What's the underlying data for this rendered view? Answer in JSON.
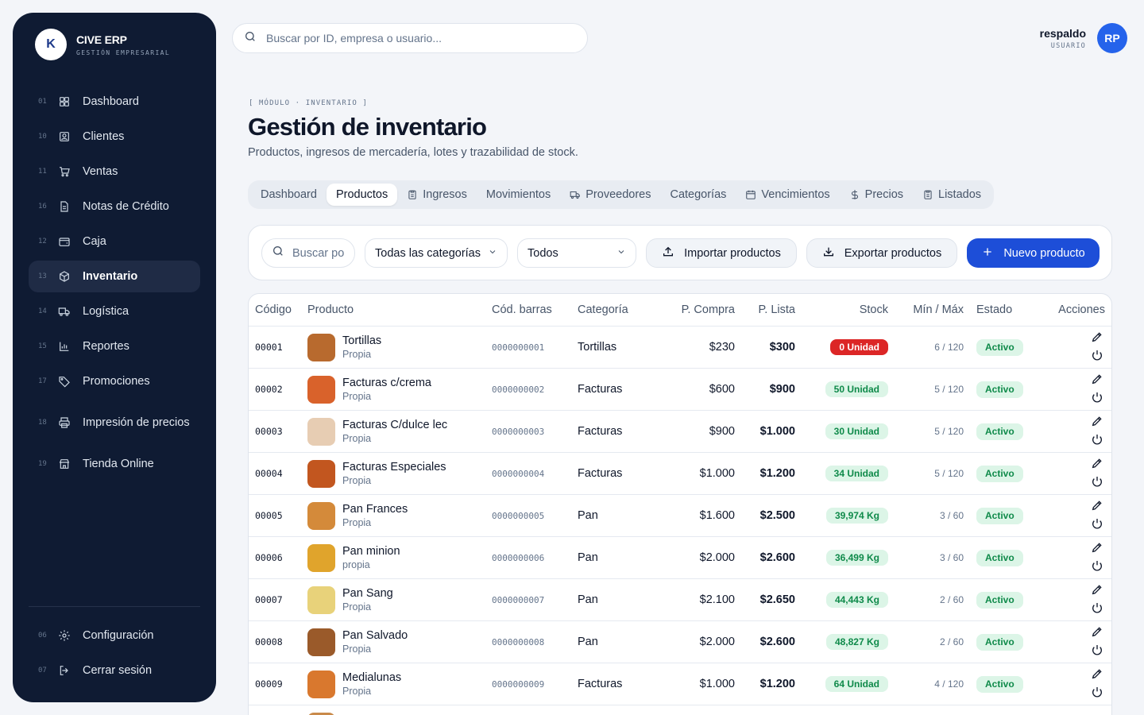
{
  "brand": {
    "logo_text": "K",
    "name": "CIVE ERP",
    "subtitle": "GESTIÓN EMPRESARIAL"
  },
  "sidebar": {
    "items": [
      {
        "num": "01",
        "label": "Dashboard",
        "icon": "dashboard-icon"
      },
      {
        "num": "10",
        "label": "Clientes",
        "icon": "clients-icon"
      },
      {
        "num": "11",
        "label": "Ventas",
        "icon": "cart-icon"
      },
      {
        "num": "16",
        "label": "Notas de Crédito",
        "icon": "document-icon"
      },
      {
        "num": "12",
        "label": "Caja",
        "icon": "wallet-icon"
      },
      {
        "num": "13",
        "label": "Inventario",
        "icon": "box-icon",
        "active": true
      },
      {
        "num": "14",
        "label": "Logística",
        "icon": "truck-icon"
      },
      {
        "num": "15",
        "label": "Reportes",
        "icon": "bar-chart-icon"
      },
      {
        "num": "17",
        "label": "Promociones",
        "icon": "tag-icon"
      },
      {
        "num": "18",
        "label": "Impresión de precios",
        "icon": "printer-icon"
      },
      {
        "num": "19",
        "label": "Tienda Online",
        "icon": "store-icon"
      }
    ],
    "bottom": [
      {
        "num": "06",
        "label": "Configuración",
        "icon": "gear-icon"
      },
      {
        "num": "07",
        "label": "Cerrar sesión",
        "icon": "logout-icon"
      }
    ]
  },
  "search": {
    "placeholder": "Buscar por ID, empresa o usuario..."
  },
  "user": {
    "name": "respaldo",
    "role": "USUARIO",
    "initials": "RP"
  },
  "header": {
    "module": "[ MÓDULO · INVENTARIO ]",
    "title": "Gestión de inventario",
    "subtitle": "Productos, ingresos de mercadería, lotes y trazabilidad de stock."
  },
  "tabs": [
    {
      "label": "Dashboard",
      "icon": ""
    },
    {
      "label": "Productos",
      "icon": "",
      "active": true
    },
    {
      "label": "Ingresos",
      "icon": "clipboard-icon"
    },
    {
      "label": "Movimientos",
      "icon": ""
    },
    {
      "label": "Proveedores",
      "icon": "truck-icon"
    },
    {
      "label": "Categorías",
      "icon": ""
    },
    {
      "label": "Vencimientos",
      "icon": "calendar-icon"
    },
    {
      "label": "Precios",
      "icon": "dollar-icon"
    },
    {
      "label": "Listados",
      "icon": "clipboard-icon"
    }
  ],
  "toolbar": {
    "search_placeholder": "Buscar po",
    "category_select": "Todas las categorías",
    "status_select": "Todos",
    "import_label": "Importar productos",
    "export_label": "Exportar productos",
    "new_label": "Nuevo producto"
  },
  "table": {
    "headers": [
      "Código",
      "Producto",
      "Cód. barras",
      "Categoría",
      "P. Compra",
      "P. Lista",
      "Stock",
      "Mín / Máx",
      "Estado",
      "Acciones"
    ],
    "rows": [
      {
        "code": "00001",
        "name": "Tortillas",
        "origin": "Propia",
        "barcode": "0000000001",
        "category": "Tortillas",
        "buy": "$230",
        "list": "$300",
        "stock": "0 Unidad",
        "stock_zero": true,
        "minmax": "6 / 120",
        "status": "Activo",
        "thumb_color": "#b86a2e"
      },
      {
        "code": "00002",
        "name": "Facturas c/crema",
        "origin": "Propia",
        "barcode": "0000000002",
        "category": "Facturas",
        "buy": "$600",
        "list": "$900",
        "stock": "50 Unidad",
        "stock_zero": false,
        "minmax": "5 / 120",
        "status": "Activo",
        "thumb_color": "#d9622b"
      },
      {
        "code": "00003",
        "name": "Facturas C/dulce lec",
        "origin": "Propia",
        "barcode": "0000000003",
        "category": "Facturas",
        "buy": "$900",
        "list": "$1.000",
        "stock": "30 Unidad",
        "stock_zero": false,
        "minmax": "5 / 120",
        "status": "Activo",
        "thumb_color": "#e7cdb3"
      },
      {
        "code": "00004",
        "name": "Facturas Especiales",
        "origin": "Propia",
        "barcode": "0000000004",
        "category": "Facturas",
        "buy": "$1.000",
        "list": "$1.200",
        "stock": "34 Unidad",
        "stock_zero": false,
        "minmax": "5 / 120",
        "status": "Activo",
        "thumb_color": "#c2561f"
      },
      {
        "code": "00005",
        "name": "Pan Frances",
        "origin": "Propia",
        "barcode": "0000000005",
        "category": "Pan",
        "buy": "$1.600",
        "list": "$2.500",
        "stock": "39,974 Kg",
        "stock_zero": false,
        "minmax": "3 / 60",
        "status": "Activo",
        "thumb_color": "#d48a3a"
      },
      {
        "code": "00006",
        "name": "Pan minion",
        "origin": "propia",
        "barcode": "0000000006",
        "category": "Pan",
        "buy": "$2.000",
        "list": "$2.600",
        "stock": "36,499 Kg",
        "stock_zero": false,
        "minmax": "3 / 60",
        "status": "Activo",
        "thumb_color": "#e0a42c"
      },
      {
        "code": "00007",
        "name": "Pan Sang",
        "origin": "Propia",
        "barcode": "0000000007",
        "category": "Pan",
        "buy": "$2.100",
        "list": "$2.650",
        "stock": "44,443 Kg",
        "stock_zero": false,
        "minmax": "2 / 60",
        "status": "Activo",
        "thumb_color": "#e8d27a"
      },
      {
        "code": "00008",
        "name": "Pan Salvado",
        "origin": "Propia",
        "barcode": "0000000008",
        "category": "Pan",
        "buy": "$2.000",
        "list": "$2.600",
        "stock": "48,827 Kg",
        "stock_zero": false,
        "minmax": "2 / 60",
        "status": "Activo",
        "thumb_color": "#9a5a2a"
      },
      {
        "code": "00009",
        "name": "Medialunas",
        "origin": "Propia",
        "barcode": "0000000009",
        "category": "Facturas",
        "buy": "$1.000",
        "list": "$1.200",
        "stock": "64 Unidad",
        "stock_zero": false,
        "minmax": "4 / 120",
        "status": "Activo",
        "thumb_color": "#d9782e"
      },
      {
        "code": "",
        "name": "",
        "origin": "",
        "barcode": "",
        "category": "",
        "buy": "",
        "list": "",
        "stock": "",
        "stock_zero": false,
        "minmax": "",
        "status": "",
        "thumb_color": "#c98a4a"
      }
    ]
  },
  "colors": {
    "sidebar_bg": "#0f1b33",
    "accent": "#1d4ed8",
    "success": "#0f8a4a",
    "danger": "#dc2626"
  }
}
